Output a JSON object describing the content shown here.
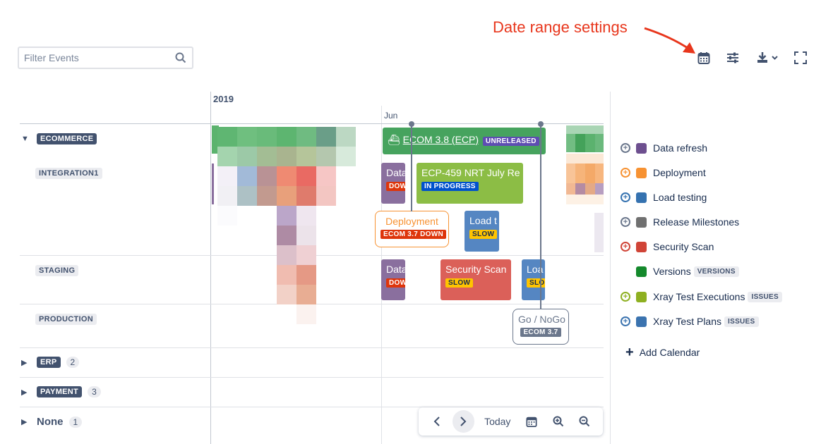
{
  "annotation": {
    "text": "Date range settings"
  },
  "filter": {
    "placeholder": "Filter Events",
    "value": ""
  },
  "toolbar": {
    "date_range_icon": "calendar-icon",
    "settings_icon": "sliders-icon",
    "download_icon": "download-icon",
    "fullscreen_icon": "fullscreen-icon"
  },
  "timeline": {
    "year": "2019",
    "month": "Jun"
  },
  "groups": {
    "ecommerce": {
      "label": "ECOMMERCE",
      "expanded": true
    },
    "integration": {
      "label": "INTEGRATION1"
    },
    "staging": {
      "label": "STAGING"
    },
    "production": {
      "label": "PRODUCTION"
    },
    "erp": {
      "label": "ERP",
      "count": "2"
    },
    "payment": {
      "label": "PAYMENT",
      "count": "3"
    },
    "none": {
      "label": "None",
      "count": "1"
    }
  },
  "events": {
    "ecom38": {
      "label": "ECOM 3.8 (ECP)",
      "tag": "UNRELEASED",
      "color": "#46a35e"
    },
    "data1": {
      "label": "Data",
      "tag": "DOW",
      "color": "#8a6f9e"
    },
    "ecp459": {
      "label": "ECP-459 NRT July Re",
      "tag": "IN PROGRESS",
      "color": "#8cbd45"
    },
    "deployment": {
      "label": "Deployment",
      "tag": "ECOM 3.7 DOWN",
      "color": "#f79232"
    },
    "load1": {
      "label": "Load t",
      "tag": "SLOW",
      "color": "#5586c2"
    },
    "data2": {
      "label": "Data",
      "tag": "DOW",
      "color": "#8a6f9e"
    },
    "security": {
      "label": "Security Scan",
      "tag": "SLOW",
      "color": "#db6059"
    },
    "load2": {
      "label": "Loa",
      "tag": "SLO",
      "color": "#5586c2"
    },
    "gonogo": {
      "label": "Go / NoGo",
      "tag": "ECOM 3.7"
    }
  },
  "legend": [
    {
      "label": "Data refresh",
      "color": "#6d4f8f",
      "plus_color": "#6b778c",
      "badge": ""
    },
    {
      "label": "Deployment",
      "color": "#f79232",
      "plus_color": "#f79232",
      "badge": ""
    },
    {
      "label": "Load testing",
      "color": "#3572b0",
      "plus_color": "#3572b0",
      "badge": ""
    },
    {
      "label": "Release Milestones",
      "color": "#707070",
      "plus_color": "#6b778c",
      "badge": ""
    },
    {
      "label": "Security Scan",
      "color": "#d04437",
      "plus_color": "#d04437",
      "badge": ""
    },
    {
      "label": "Versions",
      "color": "#14892c",
      "plus_color": "",
      "badge": "VERSIONS"
    },
    {
      "label": "Xray Test Executions",
      "color": "#8eb021",
      "plus_color": "#8eb021",
      "badge": "ISSUES"
    },
    {
      "label": "Xray Test Plans",
      "color": "#3b73af",
      "plus_color": "#3b73af",
      "badge": "ISSUES"
    }
  ],
  "add_calendar": {
    "label": "Add Calendar"
  },
  "navbar": {
    "today": "Today"
  }
}
